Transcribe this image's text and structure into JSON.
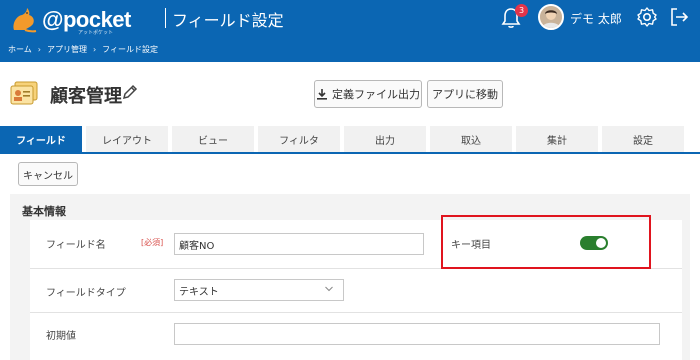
{
  "header": {
    "logo_text": "@pocket",
    "logo_subtext": "アットポケット",
    "title": "フィールド設定",
    "notification_count": "3",
    "user_name": "デモ 太郎"
  },
  "breadcrumb": [
    "ホーム",
    "アプリ管理",
    "フィールド設定"
  ],
  "app": {
    "title": "顧客管理",
    "export_button": "定義ファイル出力",
    "move_button": "アプリに移動"
  },
  "tabs": [
    {
      "label": "フィールド",
      "active": true
    },
    {
      "label": "レイアウト",
      "active": false
    },
    {
      "label": "ビュー",
      "active": false
    },
    {
      "label": "フィルタ",
      "active": false
    },
    {
      "label": "出力",
      "active": false
    },
    {
      "label": "取込",
      "active": false
    },
    {
      "label": "集計",
      "active": false
    },
    {
      "label": "設定",
      "active": false
    }
  ],
  "cancel_button": "キャンセル",
  "form": {
    "section_title": "基本情報",
    "field_name_label": "フィールド名",
    "required_badge": "[必須]",
    "field_name_value": "顧客NO",
    "key_item_label": "キー項目",
    "key_item_on": true,
    "field_type_label": "フィールドタイプ",
    "field_type_value": "テキスト",
    "default_value_label": "初期値",
    "default_value": ""
  },
  "colors": {
    "primary": "#0b66b3",
    "toggle_on": "#2a7f2e",
    "highlight": "#e0141e",
    "required": "#d9534f"
  }
}
